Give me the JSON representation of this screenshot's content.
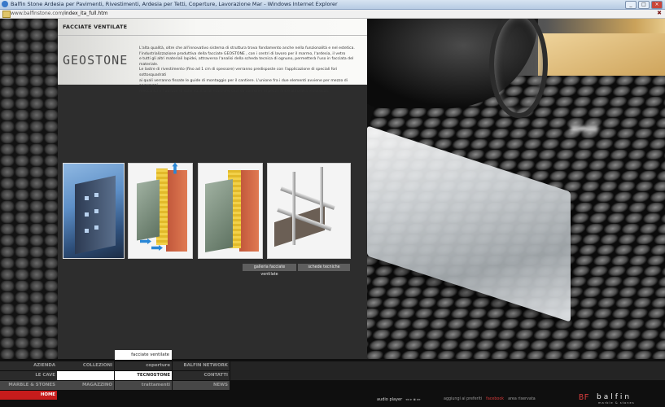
{
  "browser": {
    "title": "Balfin Stone Ardesia per Pavimenti, Rivestimenti, Ardesia per Tetti, Coperture, Lavorazione Mar - Windows Internet Explorer",
    "url_host": "www.balfinstone.com",
    "url_path": "/index_ita_full.htm"
  },
  "content": {
    "section_title": "FACCIATE VENTILATE",
    "logo_text": "GEOSTONE",
    "description": [
      "L'alta qualità, oltre che all'innovativo sistema di struttura trova fondamento anche nella funzionalità e nel estetica.",
      "l'industrializzazione produttiva della facciate GEOSTONE , con i centri di lavoro per il marmo, l'ardesia, il vetro",
      "e tutti gli altri materiali lapidei, attraverso l'analisi della scheda tecnica di ognuno, permetterà l'uso in facciata del materiale.",
      "Le lastre di rivestimento (fino ad 1 cm di spessore) verranno predisposte con l'applicazione di speciali fori sottosquadrati",
      "ai quali verranno fissate le guide di montaggio per il cantiere. L'unione fra i due elementi avviene per mezzo di ancoraggi",
      "meccanici e l'utilizzo di colle strutturali elastiche così da conferire al pezzo finito altissima resistenza."
    ],
    "links": {
      "gallery": "galleria facciate ventilate",
      "specs": "schede tecniche"
    }
  },
  "nav": {
    "col1": [
      "AZIENDA",
      "LE CAVE",
      "MARBLE & STONES",
      "HOME"
    ],
    "col2": [
      "COLLEZIONI",
      "",
      "MAGAZZINO"
    ],
    "col3": [
      "coperture",
      "TECNOSTONE",
      "trattamenti"
    ],
    "col3_sub": "facciate ventilate",
    "col4": [
      "BALFIN NETWORK",
      "CONTATTI",
      "NEWS"
    ]
  },
  "footer": {
    "audio_player": "audio player",
    "controls": "◂◂ ▸ ▪ ▸▸",
    "favorites": "aggiungi ai preferiti",
    "facebook": "facebook",
    "reserved": "area riservata",
    "brand_mark": "BF",
    "brand_name": "balfin",
    "brand_tagline": "marble & stones"
  }
}
